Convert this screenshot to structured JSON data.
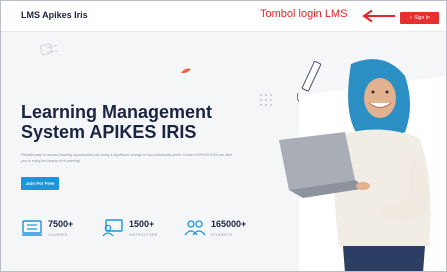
{
  "navbar": {
    "brand": "LMS Apikes Iris",
    "annotation": "Tombol login LMS",
    "signin_label": "Sign In"
  },
  "hero": {
    "title_line1": "Learning Management",
    "title_line2": "System APIKES IRIS",
    "description": "Flexible easy to access learning opportunities can bring a significant change in how individuals prefer to learn! APIKES IRIS can offer you to enjoy the beauty of eLearning!",
    "cta_label": "Join For Free"
  },
  "stats": [
    {
      "value": "7500+",
      "label": "COURSES",
      "icon": "course-icon"
    },
    {
      "value": "1500+",
      "label": "INSTRUCTORS",
      "icon": "instructor-icon"
    },
    {
      "value": "165000+",
      "label": "STUDENTS",
      "icon": "students-icon"
    }
  ],
  "colors": {
    "primary_text": "#1b2441",
    "accent_blue": "#1b95dd",
    "signin_red": "#e5302f",
    "annotation_red": "#e8232a",
    "hijab": "#2b8fc4"
  }
}
